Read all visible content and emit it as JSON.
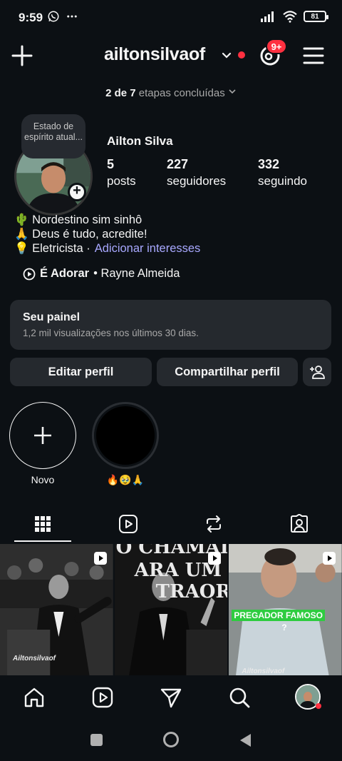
{
  "status_bar": {
    "time": "9:59",
    "battery": "81"
  },
  "header": {
    "username": "ailtonsilvaof",
    "threads_badge": "9+"
  },
  "onboarding": {
    "done": "2 de 7",
    "rest": "etapas concluídas"
  },
  "profile": {
    "note": "Estado de espírito atual...",
    "full_name": "Ailton Silva",
    "stats": [
      {
        "value": "5",
        "label": "posts"
      },
      {
        "value": "227",
        "label": "seguidores"
      },
      {
        "value": "332",
        "label": "seguindo"
      }
    ]
  },
  "bio": {
    "line1": "🌵 Nordestino sim sinhô",
    "line2": "🙏 Deus é tudo, acredite!",
    "line3": "💡 Eletricista ·",
    "interests_link": "Adicionar interesses"
  },
  "music": {
    "song": "É Adorar",
    "artist": "• Rayne Almeida"
  },
  "dashboard": {
    "title": "Seu painel",
    "subtitle": "1,2 mil visualizações nos últimos 30 dias."
  },
  "buttons": {
    "edit": "Editar perfil",
    "share": "Compartilhar perfil"
  },
  "highlights": [
    {
      "label": "Novo"
    },
    {
      "label": "🔥🥹🙏"
    }
  ],
  "grid": [
    {
      "watermark": "Ailtonsilvaof",
      "caption": ""
    },
    {
      "watermark": "",
      "caption": "O CHAMADO PARA UM EXTRAORDINÁRIO"
    },
    {
      "watermark": "Ailtonsilvaof",
      "caption": "PREGADOR FAMOSO ?"
    }
  ],
  "grid_overlay": {
    "line1": "O CHAMAD",
    "line2": "ARA UM",
    "line3": "TRAOR",
    "pregador": "PREGADOR FAMOSO",
    "qmark": "?"
  },
  "colors": {
    "background": "#0c1014",
    "card": "#25292e",
    "accent_red": "#ff3040",
    "link": "#a8a8ff"
  }
}
